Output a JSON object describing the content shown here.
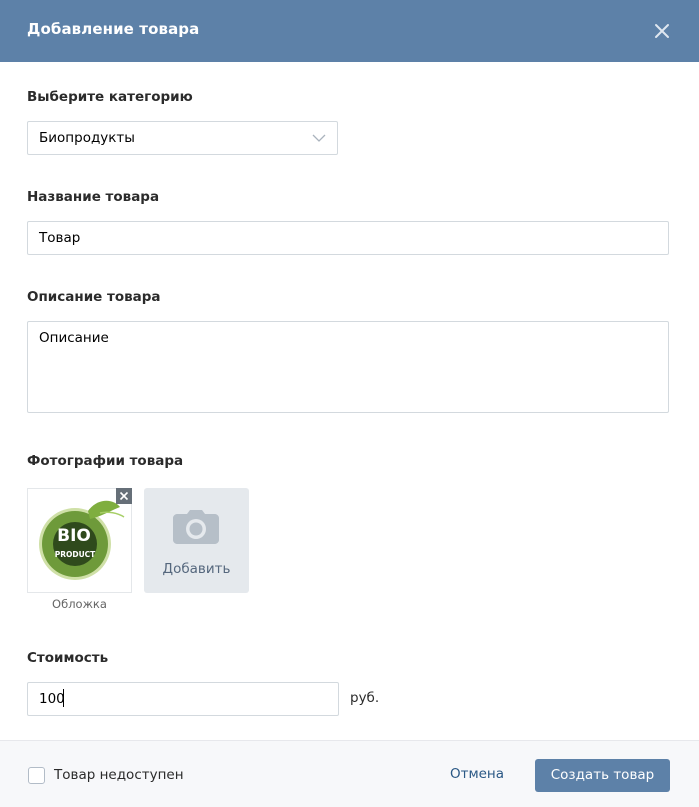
{
  "modal": {
    "title": "Добавление товара",
    "close_icon": "close-icon"
  },
  "category": {
    "label": "Выберите категорию",
    "selected": "Биопродукты",
    "icon": "chevron-down-icon"
  },
  "name": {
    "label": "Название товара",
    "value": "Товар"
  },
  "description": {
    "label": "Описание товара",
    "value": "Описание"
  },
  "photos": {
    "label": "Фотографии товара",
    "items": [
      {
        "image_text_top": "BIO",
        "image_text_bottom": "PRODUCT",
        "caption": "Обложка"
      }
    ],
    "add_label": "Добавить",
    "add_icon": "camera-icon",
    "remove_icon": "close-icon"
  },
  "price": {
    "label": "Стоимость",
    "value": "100",
    "currency": "руб."
  },
  "footer": {
    "unavailable_label": "Товар недоступен",
    "cancel_label": "Отмена",
    "submit_label": "Создать товар"
  },
  "colors": {
    "header": "#5d81a8",
    "link": "#2a5885",
    "button": "#5d81a8"
  }
}
